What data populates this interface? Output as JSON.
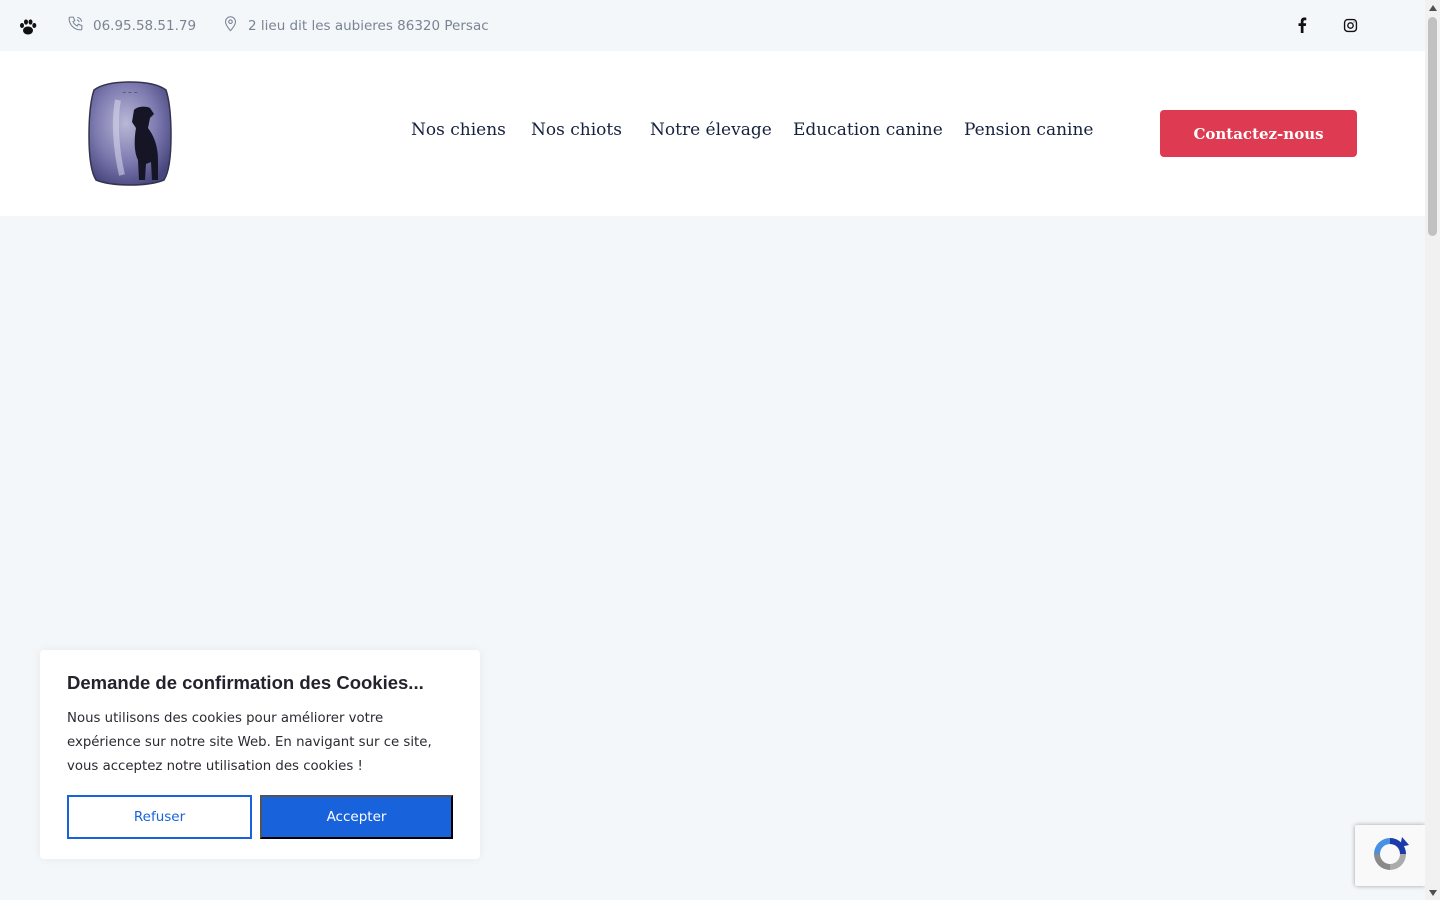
{
  "topbar": {
    "phone": "06.95.58.51.79",
    "address": "2 lieu dit les aubieres 86320 Persac",
    "paw_icon": "paw-icon",
    "phone_icon": "phone-icon",
    "address_icon": "map-pin-icon",
    "social": [
      "facebook-icon",
      "instagram-icon"
    ]
  },
  "header": {
    "nav": [
      "Nos chiens",
      "Nos chiots",
      "Notre élevage",
      "Education canine",
      "Pension canine"
    ],
    "cta_label": "Contactez-nous"
  },
  "cookie": {
    "title": "Demande de confirmation des Cookies...",
    "text": "Nous utilisons des cookies pour améliorer votre expérience sur notre site Web. En navigant sur ce site, vous acceptez notre utilisation des cookies !",
    "refuse_label": "Refuser",
    "accept_label": "Accepter"
  },
  "colors": {
    "accent": "#de3a51",
    "cookie_button": "#1863dc",
    "nav_text": "#16213e",
    "background": "#f4f7f9"
  }
}
